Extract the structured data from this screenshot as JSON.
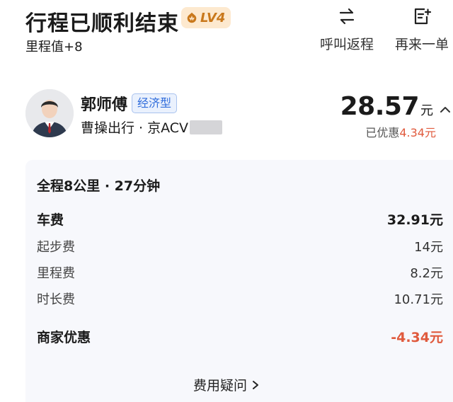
{
  "header": {
    "title": "行程已顺利结束",
    "level_badge": "LV4",
    "subtitle": "里程值+8",
    "actions": [
      {
        "label": "呼叫返程",
        "icon": "swap-arrows-icon"
      },
      {
        "label": "再来一单",
        "icon": "add-order-icon"
      }
    ]
  },
  "driver": {
    "name": "郭师傅",
    "ride_type": "经济型",
    "provider_plate": "曹操出行 · 京ACV"
  },
  "price": {
    "amount": "28.57",
    "unit": "元",
    "discount_prefix": "已优惠",
    "discount_amount": "4.34元"
  },
  "trip": {
    "summary": "全程8公里 · 27分钟"
  },
  "fees": {
    "total_label": "车费",
    "total_value": "32.91元",
    "items": [
      {
        "label": "起步费",
        "value": "14元"
      },
      {
        "label": "里程费",
        "value": "8.2元"
      },
      {
        "label": "时长费",
        "value": "10.71元"
      }
    ],
    "discount_label": "商家优惠",
    "discount_value": "-4.34元"
  },
  "faq_label": "费用疑问",
  "colors": {
    "accent_orange": "#c9781b",
    "badge_bg": "#fde9cf",
    "ride_type_blue": "#2f6cdb",
    "discount_red": "#e05a3d",
    "panel_bg": "#f7f8fc"
  }
}
